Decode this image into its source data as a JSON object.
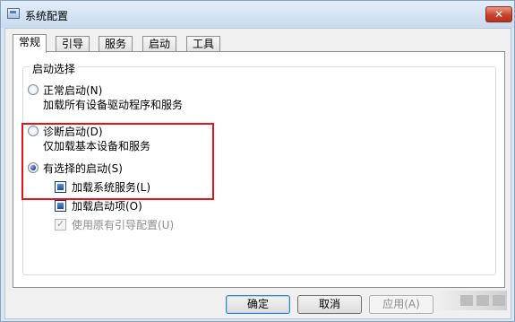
{
  "window": {
    "title": "系统配置",
    "close_glyph": "✕"
  },
  "tabs": [
    "常规",
    "引导",
    "服务",
    "启动",
    "工具"
  ],
  "group": {
    "label": "启动选择",
    "options": [
      {
        "label": "正常启动(N)",
        "desc": "加载所有设备驱动程序和服务",
        "checked": false
      },
      {
        "label": "诊断启动(D)",
        "desc": "仅加载基本设备和服务",
        "checked": false
      },
      {
        "label": "有选择的启动(S)",
        "checked": true
      }
    ],
    "selective_items": [
      {
        "label": "加载系统服务(L)",
        "checked": true,
        "enabled": true
      },
      {
        "label": "加载启动项(O)",
        "checked": true,
        "enabled": true
      },
      {
        "label": "使用原有引导配置(U)",
        "checked": true,
        "enabled": false
      }
    ]
  },
  "buttons": {
    "ok": "确定",
    "cancel": "取消",
    "apply": "应用(A)"
  },
  "colors": {
    "highlight_border": "#e2141a",
    "close_button": "#c7432c"
  }
}
